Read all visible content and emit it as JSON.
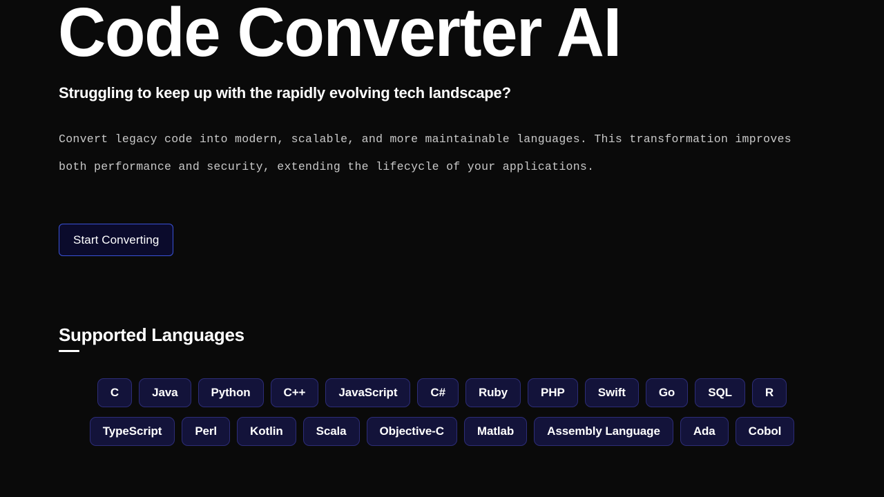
{
  "theme": {
    "background": "#0a0a0a",
    "text_primary": "#ffffff",
    "text_muted": "#c9c9c9",
    "accent_border": "#3a52d8",
    "pill_background": "#13133a",
    "pill_border": "#2d2d78",
    "button_background": "#0b0b2c"
  },
  "hero": {
    "title": "Code Converter AI",
    "subtitle": "Struggling to keep up with the rapidly evolving tech landscape?",
    "paragraph": "Convert legacy code into modern, scalable, and more maintainable languages. This transformation improves both performance and security, extending the lifecycle of your applications.",
    "cta_label": "Start Converting"
  },
  "supported_languages": {
    "heading": "Supported Languages",
    "rows": [
      [
        "C",
        "Java",
        "Python",
        "C++",
        "JavaScript",
        "C#",
        "Ruby",
        "PHP",
        "Swift",
        "Go",
        "SQL",
        "R"
      ],
      [
        "TypeScript",
        "Perl",
        "Kotlin",
        "Scala",
        "Objective-C",
        "Matlab",
        "Assembly Language",
        "Ada",
        "Cobol"
      ]
    ]
  }
}
